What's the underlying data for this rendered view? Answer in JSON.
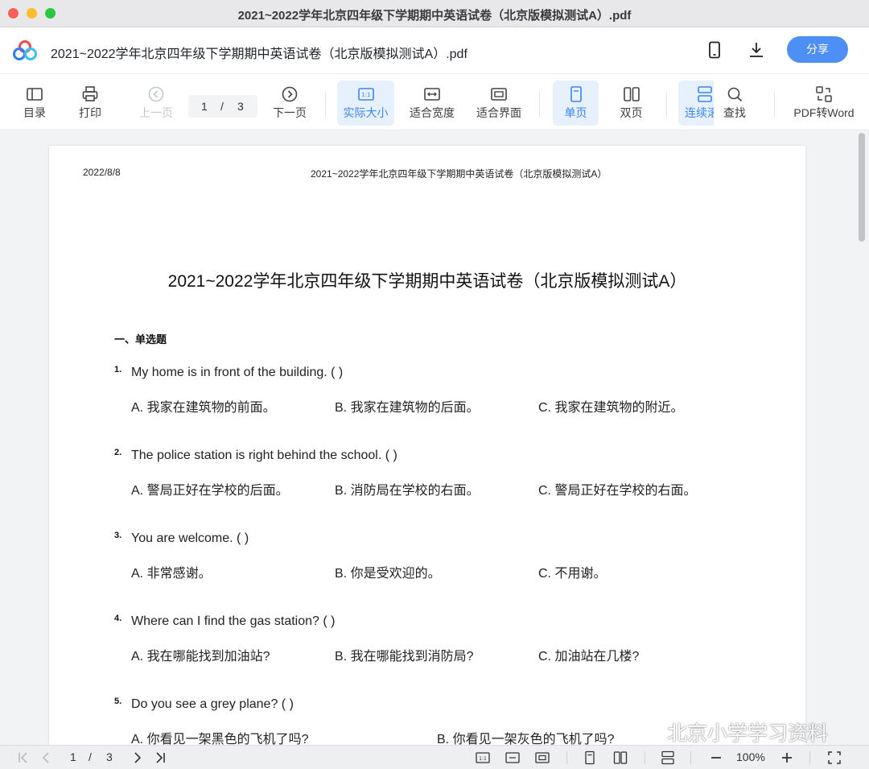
{
  "window": {
    "title": "2021~2022学年北京四年级下学期期中英语试卷（北京版模拟测试A）.pdf"
  },
  "header": {
    "doc_title": "2021~2022学年北京四年级下学期期中英语试卷（北京版模拟测试A）.pdf",
    "share_label": "分享"
  },
  "toolbar": {
    "toc_label": "目录",
    "print_label": "打印",
    "prev_label": "上一页",
    "page_current": "1",
    "page_sep": "/",
    "page_total": "3",
    "next_label": "下一页",
    "actual_size_label": "实际大小",
    "fit_width_label": "适合宽度",
    "fit_page_label": "适合界面",
    "single_label": "单页",
    "double_label": "双页",
    "continuous_label": "连续滚动",
    "find_label": "查找",
    "pdf2word_label": "PDF转Word"
  },
  "page": {
    "date": "2022/8/8",
    "running_head": "2021~2022学年北京四年级下学期期中英语试卷（北京版模拟测试A）",
    "title": "2021~2022学年北京四年级下学期期中英语试卷（北京版模拟测试A）",
    "section": "一、单选题",
    "questions": [
      {
        "num": "1.",
        "text": "My home is in front of the building. (     )",
        "a": "A. 我家在建筑物的前面。",
        "b": "B. 我家在建筑物的后面。",
        "c": "C. 我家在建筑物的附近。"
      },
      {
        "num": "2.",
        "text": "The police station is right behind the school. (     )",
        "a": "A. 警局正好在学校的后面。",
        "b": "B. 消防局在学校的右面。",
        "c": "C. 警局正好在学校的右面。"
      },
      {
        "num": "3.",
        "text": "You are welcome. (     )",
        "a": "A. 非常感谢。",
        "b": "B. 你是受欢迎的。",
        "c": "C. 不用谢。"
      },
      {
        "num": "4.",
        "text": "Where can I find the gas station? (     )",
        "a": "A. 我在哪能找到加油站?",
        "b": "B. 我在哪能找到消防局?",
        "c": "C. 加油站在几楼?"
      },
      {
        "num": "5.",
        "text": "Do you see a grey plane? (     )",
        "a": "A. 你看见一架黑色的飞机了吗?",
        "b": "B. 你看见一架灰色的飞机了吗?"
      }
    ]
  },
  "watermark": {
    "text": "北京小学学习资料"
  },
  "bottombar": {
    "page_current": "1",
    "page_sep": "/",
    "page_total": "3",
    "zoom": "100%"
  },
  "colors": {
    "accent": "#4d8ff5",
    "active_bg": "#e7f0fd",
    "active_text": "#3a85f0"
  },
  "icons": [
    "phone-icon",
    "download-icon",
    "toc-icon",
    "print-icon",
    "prev-page-icon",
    "next-page-icon",
    "actual-size-icon",
    "fit-width-icon",
    "fit-page-icon",
    "single-page-icon",
    "double-page-icon",
    "continuous-icon",
    "search-icon",
    "pdf-to-word-icon",
    "first-page-icon",
    "last-page-icon",
    "zoom-in-icon",
    "zoom-out-icon",
    "fullscreen-icon",
    "wechat-icon"
  ]
}
